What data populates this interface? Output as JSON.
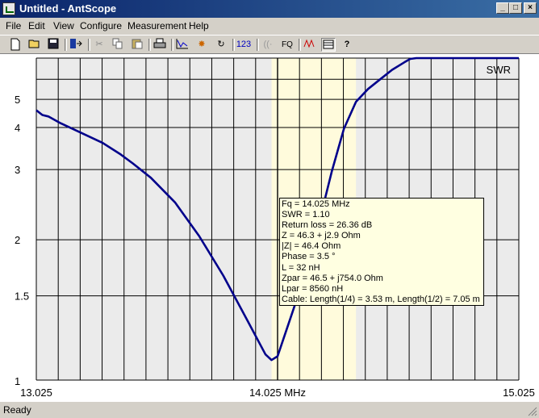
{
  "window": {
    "title": "Untitled - AntScope",
    "buttons": [
      "_",
      "□",
      "×"
    ]
  },
  "menu": [
    "File",
    "Edit",
    "View",
    "Configure",
    "Measurement",
    "Help"
  ],
  "toolbar": {
    "icons": [
      "new-icon",
      "open-icon",
      "save-icon",
      "export-icon",
      "cut-icon",
      "copy-icon",
      "paste-icon",
      "print-icon",
      "chart-icon",
      "sparkle-icon",
      "refresh-icon",
      "numbers-icon",
      "wireless-icon",
      "fq-icon",
      "series-icon",
      "table-icon",
      "help-icon"
    ],
    "numbers_label": "123",
    "fq_label": "FQ"
  },
  "status": {
    "text": "Ready"
  },
  "chart_data": {
    "type": "line",
    "series": [
      {
        "name": "SWR",
        "color": "#00008b",
        "x": [
          13.025,
          13.05,
          13.075,
          13.125,
          13.2,
          13.3,
          13.375,
          13.425,
          13.5,
          13.6,
          13.7,
          13.8,
          13.9,
          13.975,
          14.0,
          14.025,
          14.05,
          14.1,
          14.15,
          14.2,
          14.25,
          14.3,
          14.35,
          14.4,
          14.45,
          14.5,
          14.55,
          14.575,
          14.6,
          14.65,
          14.7,
          15.025
        ],
        "values": [
          4.57,
          4.4,
          4.35,
          4.13,
          3.88,
          3.58,
          3.31,
          3.12,
          2.85,
          2.46,
          2.04,
          1.66,
          1.33,
          1.13,
          1.1,
          1.12,
          1.22,
          1.45,
          1.75,
          2.23,
          2.97,
          3.96,
          4.9,
          5.48,
          6.0,
          6.6,
          7.15,
          7.43,
          7.5,
          7.5,
          7.5,
          7.5
        ]
      }
    ],
    "x_min": 13.025,
    "x_max": 15.025,
    "x_ticks": [
      {
        "label": "13.025",
        "value": 13.025
      },
      {
        "label": "14.025 MHz",
        "value": 14.025
      },
      {
        "label": "15.025",
        "value": 15.025
      }
    ],
    "y_ticks": [
      1,
      1.5,
      2,
      3,
      4,
      5
    ],
    "y_scale": "vswr",
    "y_range": [
      1,
      7.5
    ],
    "grid": true,
    "vertical_gridlines": 22,
    "band_highlight": [
      14.0,
      14.35
    ],
    "marker_x": 14.025,
    "legend_label": "SWR",
    "legend_position": "top-right",
    "annotation": [
      "Fq = 14.025 MHz",
      "SWR = 1.10",
      "Return loss = 26.36 dB",
      "Z = 46.3 + j2.9 Ohm",
      "|Z| = 46.4 Ohm",
      "Phase = 3.5 °",
      "L = 32 nH",
      "Zpar = 46.5 + j754.0 Ohm",
      "Lpar = 8560 nH",
      "Cable: Length(1/4) = 3.53 m, Length(1/2) = 7.05 m"
    ]
  }
}
